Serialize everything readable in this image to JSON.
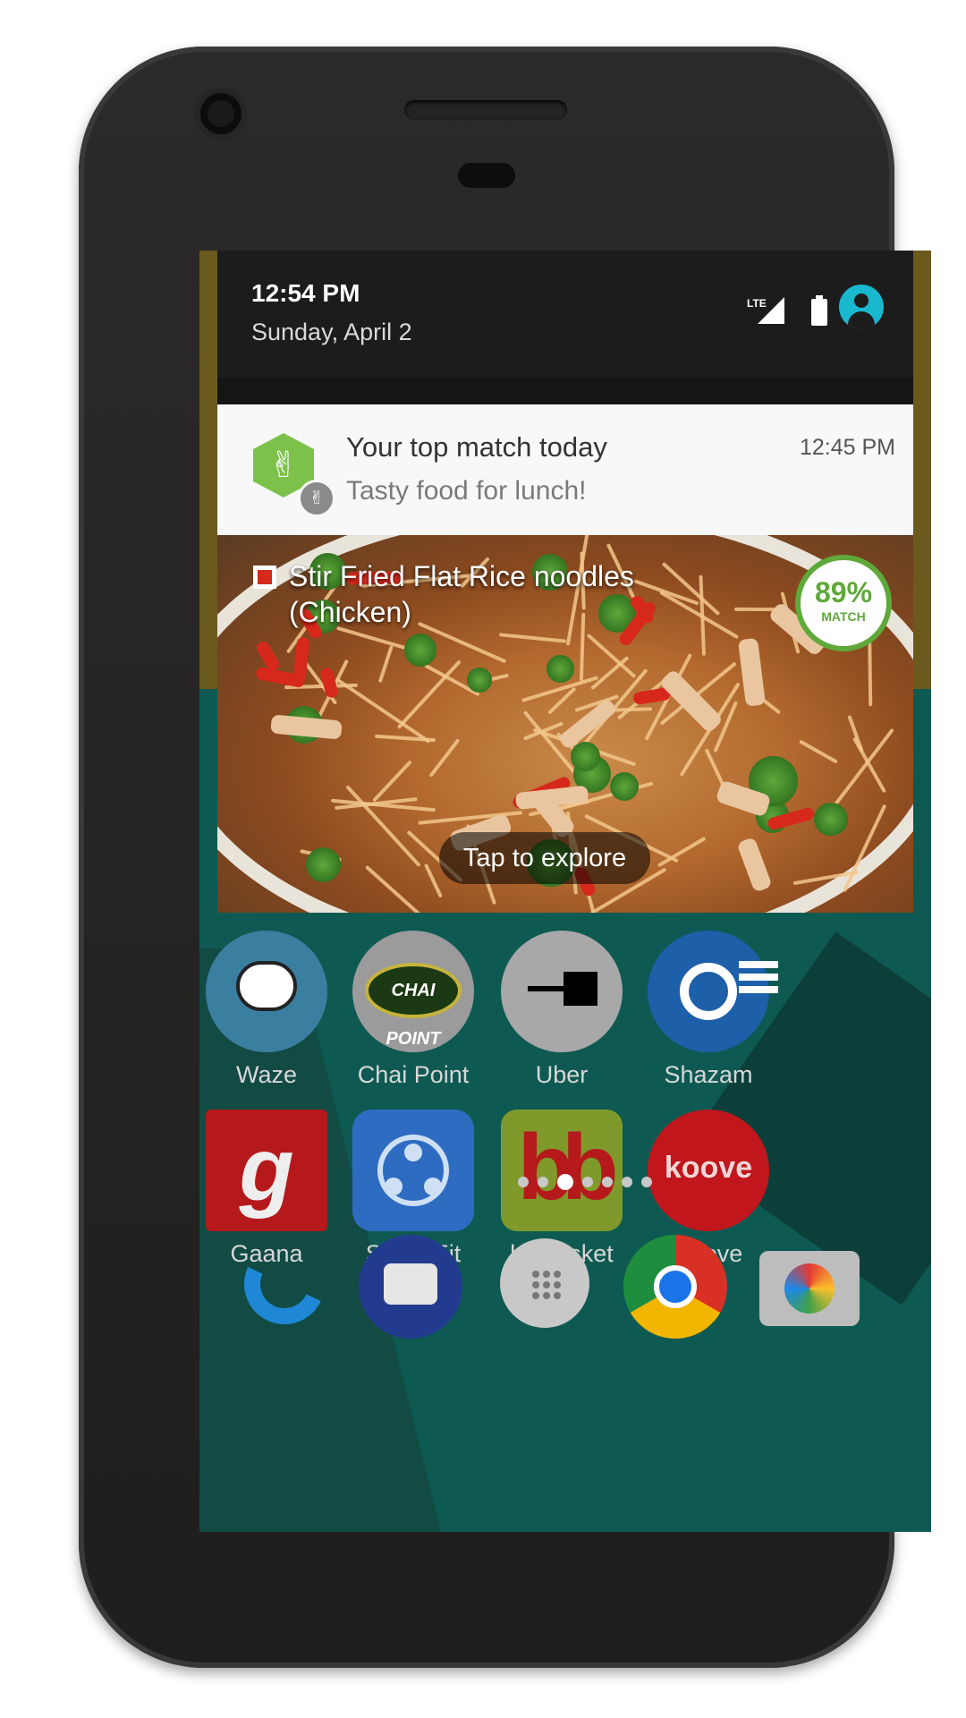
{
  "status_bar": {
    "time": "12:54 PM",
    "date": "Sunday, April 2",
    "network": "LTE"
  },
  "notification": {
    "title": "Your top match today",
    "time": "12:45 PM",
    "subtitle": "Tasty food for lunch!",
    "dish_name": "Stir Fried Flat Rice noodles (Chicken)",
    "match_percent": "89%",
    "match_label": "MATCH",
    "cta": "Tap to explore",
    "accent": "#7cc24a"
  },
  "home": {
    "row1": [
      {
        "name": "Waze",
        "icon": "waze-icon"
      },
      {
        "name": "Chai Point",
        "icon": "chai-point-icon"
      },
      {
        "name": "Uber",
        "icon": "uber-icon"
      },
      {
        "name": "Shazam",
        "icon": "shazam-icon"
      }
    ],
    "row2": [
      {
        "name": "Gaana",
        "icon": "gaana-icon"
      },
      {
        "name": "SHAREit",
        "icon": "shareit-icon"
      },
      {
        "name": "bigbasket",
        "icon": "bigbasket-icon"
      },
      {
        "name": "Koove",
        "icon": "koove-icon"
      }
    ],
    "chai_logo_text": "CHAI POINT",
    "gaana_logo_text": "g",
    "koove_logo_text": "koove",
    "bigbasket_logo_text": "bb",
    "page_dots": 7,
    "active_page": 3,
    "dock": [
      "phone-icon",
      "messages-icon",
      "app-drawer-icon",
      "chrome-icon",
      "camera-icon"
    ]
  }
}
